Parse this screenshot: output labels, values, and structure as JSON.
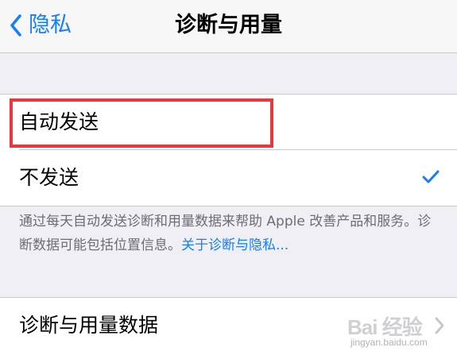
{
  "nav": {
    "back_label": "隐私",
    "title": "诊断与用量"
  },
  "options": [
    {
      "label": "自动发送",
      "selected": false
    },
    {
      "label": "不发送",
      "selected": true
    }
  ],
  "footer": {
    "text": "通过每天自动发送诊断和用量数据来帮助 Apple 改善产品和服务。诊断数据可能包括位置信息。",
    "link": "关于诊断与隐私..."
  },
  "data_row": {
    "label": "诊断与用量数据"
  },
  "watermark": {
    "main": "Bai 经验",
    "sub": "jingyan.baidu.com"
  },
  "colors": {
    "accent": "#157efb",
    "highlight": "#e8383d",
    "background": "#efeff4"
  }
}
